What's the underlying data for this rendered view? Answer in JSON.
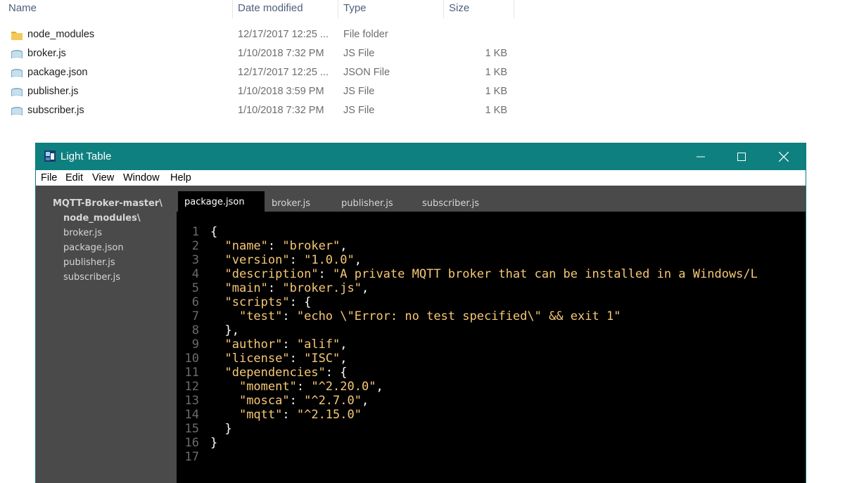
{
  "explorer": {
    "columns": {
      "name": "Name",
      "date": "Date modified",
      "type": "Type",
      "size": "Size"
    },
    "files": [
      {
        "name": "node_modules",
        "date": "12/17/2017 12:25 ...",
        "type": "File folder",
        "size": "",
        "icon": "folder-icon"
      },
      {
        "name": "broker.js",
        "date": "1/10/2018 7:32 PM",
        "type": "JS File",
        "size": "1 KB",
        "icon": "js-file-icon"
      },
      {
        "name": "package.json",
        "date": "12/17/2017 12:25 ...",
        "type": "JSON File",
        "size": "1 KB",
        "icon": "json-file-icon"
      },
      {
        "name": "publisher.js",
        "date": "1/10/2018 3:59 PM",
        "type": "JS File",
        "size": "1 KB",
        "icon": "js-file-icon"
      },
      {
        "name": "subscriber.js",
        "date": "1/10/2018 7:32 PM",
        "type": "JS File",
        "size": "1 KB",
        "icon": "js-file-icon"
      }
    ]
  },
  "lighttable": {
    "title": "Light Table",
    "colors": {
      "titlebar": "#0f8080",
      "panel": "#4a4a4a",
      "editor_bg": "#000000",
      "string": "#f7c876"
    },
    "menu": [
      "File",
      "Edit",
      "View",
      "Window",
      "Help"
    ],
    "sidebar": {
      "root": "MQTT-Broker-master\\",
      "items": [
        "node_modules\\",
        "broker.js",
        "package.json",
        "publisher.js",
        "subscriber.js"
      ]
    },
    "tabs": [
      "package.json",
      "broker.js",
      "publisher.js",
      "subscriber.js"
    ],
    "active_tab": "package.json",
    "code": {
      "line_numbers": [
        "1",
        "2",
        "3",
        "4",
        "5",
        "6",
        "7",
        "8",
        "9",
        "10",
        "11",
        "12",
        "13",
        "14",
        "15",
        "16",
        "17"
      ],
      "lines": [
        "{",
        "  \"name\": \"broker\",",
        "  \"version\": \"1.0.0\",",
        "  \"description\": \"A private MQTT broker that can be installed in a Windows/L",
        "  \"main\": \"broker.js\",",
        "  \"scripts\": {",
        "    \"test\": \"echo \\\"Error: no test specified\\\" && exit 1\"",
        "  },",
        "  \"author\": \"alif\",",
        "  \"license\": \"ISC\",",
        "  \"dependencies\": {",
        "    \"moment\": \"^2.20.0\",",
        "    \"mosca\": \"^2.7.0\",",
        "    \"mqtt\": \"^2.15.0\"",
        "  }",
        "}",
        ""
      ]
    }
  }
}
